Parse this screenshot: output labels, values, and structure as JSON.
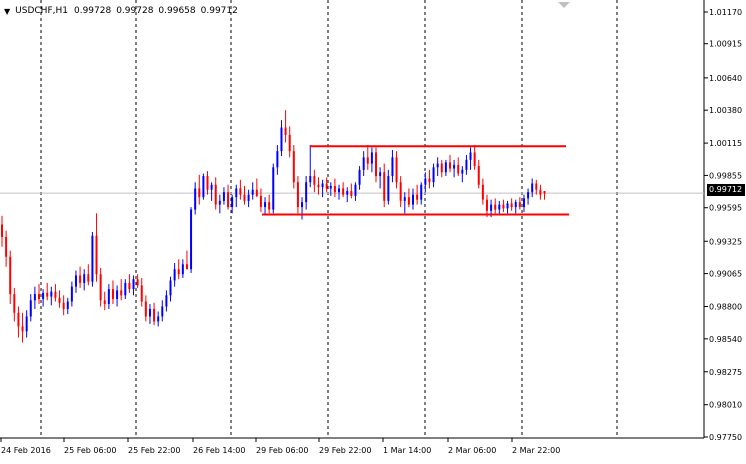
{
  "header": {
    "arrow_icon": "triangle-down-icon",
    "symbol": "USDCHF,H1",
    "open": "0.99728",
    "high": "0.99728",
    "low": "0.99658",
    "close": "0.99712"
  },
  "current_price_label": "0.99712",
  "colors": {
    "bull": "#0000ff",
    "bear": "#ff0000",
    "wick": "#000000",
    "grid": "#000000",
    "level_line": "#ff0000",
    "current_line": "#c0c0c0",
    "background": "#ffffff"
  },
  "chart_data": {
    "type": "candlestick",
    "symbol": "USDCHF",
    "timeframe": "H1",
    "ylim": [
      0.9772,
      1.0122
    ],
    "y_ticks": [
      "1.01170",
      "1.00915",
      "1.00640",
      "1.00380",
      "1.00115",
      "0.99855",
      "0.99595",
      "0.99325",
      "0.99065",
      "0.98800",
      "0.98540",
      "0.98275",
      "0.98010",
      "0.97750"
    ],
    "x_ticks": [
      "24 Feb 2016",
      "25 Feb 06:00",
      "25 Feb 22:00",
      "26 Feb 14:00",
      "29 Feb 06:00",
      "29 Feb 22:00",
      "1 Mar 14:00",
      "2 Mar 06:00",
      "2 Mar 22:00"
    ],
    "grid": "vertical dashed",
    "current_price": 0.99712,
    "resistance": 1.0009,
    "support": 0.9954,
    "candles": [
      [
        0.9946,
        0.9953,
        0.9928,
        0.9936
      ],
      [
        0.9936,
        0.9941,
        0.9912,
        0.992
      ],
      [
        0.992,
        0.9925,
        0.9882,
        0.989
      ],
      [
        0.989,
        0.9895,
        0.9868,
        0.9875
      ],
      [
        0.9875,
        0.988,
        0.9855,
        0.9864
      ],
      [
        0.9864,
        0.9875,
        0.9851,
        0.986
      ],
      [
        0.986,
        0.9877,
        0.9855,
        0.9872
      ],
      [
        0.9872,
        0.989,
        0.9868,
        0.9885
      ],
      [
        0.9885,
        0.9896,
        0.9878,
        0.989
      ],
      [
        0.989,
        0.9898,
        0.9882,
        0.9886
      ],
      [
        0.9886,
        0.9894,
        0.988,
        0.9891
      ],
      [
        0.9891,
        0.9899,
        0.9885,
        0.9888
      ],
      [
        0.9888,
        0.9896,
        0.9881,
        0.9892
      ],
      [
        0.9892,
        0.9898,
        0.9884,
        0.9887
      ],
      [
        0.9887,
        0.9893,
        0.9879,
        0.9883
      ],
      [
        0.9883,
        0.9889,
        0.9873,
        0.9878
      ],
      [
        0.9878,
        0.9887,
        0.9874,
        0.9884
      ],
      [
        0.9884,
        0.99,
        0.988,
        0.9896
      ],
      [
        0.9896,
        0.9909,
        0.9891,
        0.9905
      ],
      [
        0.9905,
        0.9912,
        0.9895,
        0.9899
      ],
      [
        0.9899,
        0.991,
        0.9893,
        0.9906
      ],
      [
        0.9906,
        0.9914,
        0.9897,
        0.99
      ],
      [
        0.99,
        0.994,
        0.9896,
        0.9937
      ],
      [
        0.9937,
        0.9955,
        0.99,
        0.9906
      ],
      [
        0.9906,
        0.9911,
        0.988,
        0.9885
      ],
      [
        0.9885,
        0.9892,
        0.9877,
        0.9882
      ],
      [
        0.9882,
        0.9898,
        0.9878,
        0.9894
      ],
      [
        0.9894,
        0.9901,
        0.9882,
        0.9886
      ],
      [
        0.9886,
        0.9897,
        0.988,
        0.9893
      ],
      [
        0.9893,
        0.9902,
        0.9885,
        0.9889
      ],
      [
        0.9889,
        0.9902,
        0.9886,
        0.9899
      ],
      [
        0.9899,
        0.9906,
        0.9891,
        0.9894
      ],
      [
        0.9894,
        0.9905,
        0.9889,
        0.9902
      ],
      [
        0.9902,
        0.9906,
        0.9895,
        0.9897
      ],
      [
        0.9897,
        0.9903,
        0.988,
        0.9884
      ],
      [
        0.9884,
        0.9889,
        0.9868,
        0.9872
      ],
      [
        0.9872,
        0.9882,
        0.9866,
        0.9878
      ],
      [
        0.9878,
        0.9883,
        0.9865,
        0.9868
      ],
      [
        0.9868,
        0.9876,
        0.9864,
        0.9872
      ],
      [
        0.9872,
        0.9885,
        0.9868,
        0.988
      ],
      [
        0.988,
        0.9893,
        0.9876,
        0.9889
      ],
      [
        0.9889,
        0.9904,
        0.9884,
        0.9901
      ],
      [
        0.9901,
        0.9915,
        0.9896,
        0.991
      ],
      [
        0.991,
        0.9918,
        0.9902,
        0.9906
      ],
      [
        0.9906,
        0.9918,
        0.9903,
        0.9914
      ],
      [
        0.9914,
        0.9925,
        0.991,
        0.991
      ],
      [
        0.991,
        0.996,
        0.9907,
        0.9958
      ],
      [
        0.9958,
        0.998,
        0.9954,
        0.9975
      ],
      [
        0.9975,
        0.9986,
        0.9962,
        0.9968
      ],
      [
        0.9968,
        0.9987,
        0.9966,
        0.9985
      ],
      [
        0.9985,
        0.9989,
        0.997,
        0.9974
      ],
      [
        0.9974,
        0.998,
        0.9965,
        0.9978
      ],
      [
        0.9978,
        0.9984,
        0.9958,
        0.9962
      ],
      [
        0.9962,
        0.997,
        0.9955,
        0.9965
      ],
      [
        0.9965,
        0.9976,
        0.9962,
        0.9972
      ],
      [
        0.9972,
        0.9978,
        0.9958,
        0.996
      ],
      [
        0.996,
        0.997,
        0.9955,
        0.9968
      ],
      [
        0.9968,
        0.9978,
        0.996,
        0.9975
      ],
      [
        0.9975,
        0.9982,
        0.9966,
        0.997
      ],
      [
        0.997,
        0.9977,
        0.9962,
        0.9965
      ],
      [
        0.9965,
        0.9974,
        0.996,
        0.997
      ],
      [
        0.997,
        0.998,
        0.9966,
        0.9974
      ],
      [
        0.9974,
        0.9983,
        0.9968,
        0.9969
      ],
      [
        0.9969,
        0.9975,
        0.9956,
        0.996
      ],
      [
        0.996,
        0.9968,
        0.9954,
        0.9964
      ],
      [
        0.9964,
        0.997,
        0.9955,
        0.9958
      ],
      [
        0.9958,
        0.9995,
        0.9955,
        0.9992
      ],
      [
        0.9992,
        1.001,
        0.9986,
        1.0005
      ],
      [
        1.0005,
        1.003,
        1.0001,
        1.0024
      ],
      [
        1.0024,
        1.0038,
        1.0012,
        1.0018
      ],
      [
        1.0018,
        1.0025,
        1.0,
        1.0005
      ],
      [
        1.0005,
        1.001,
        0.9975,
        0.998
      ],
      [
        0.998,
        0.9985,
        0.9955,
        0.996
      ],
      [
        0.996,
        0.9968,
        0.995,
        0.9964
      ],
      [
        0.9964,
        0.9985,
        0.9958,
        0.998
      ],
      [
        0.998,
        1.001,
        0.9976,
        0.9985
      ],
      [
        0.9985,
        0.999,
        0.9972,
        0.9978
      ],
      [
        0.9978,
        0.9984,
        0.997,
        0.9976
      ],
      [
        0.9976,
        0.9982,
        0.9968,
        0.9979
      ],
      [
        0.9979,
        0.9984,
        0.9972,
        0.9975
      ],
      [
        0.9975,
        0.998,
        0.9969,
        0.9977
      ],
      [
        0.9977,
        0.9983,
        0.9968,
        0.9972
      ],
      [
        0.9972,
        0.9978,
        0.9966,
        0.9975
      ],
      [
        0.9975,
        0.998,
        0.9968,
        0.997
      ],
      [
        0.997,
        0.9976,
        0.9964,
        0.9973
      ],
      [
        0.9973,
        0.9979,
        0.9967,
        0.9969
      ],
      [
        0.9969,
        0.998,
        0.9965,
        0.9978
      ],
      [
        0.9978,
        0.9993,
        0.9974,
        0.999
      ],
      [
        0.999,
        1.0005,
        0.9985,
        1.0
      ],
      [
        1.0,
        1.001,
        0.999,
        0.9995
      ],
      [
        0.9995,
        1.0008,
        0.9988,
        1.0004
      ],
      [
        1.0004,
        1.0008,
        0.998,
        0.9985
      ],
      [
        0.9985,
        0.9992,
        0.9975,
        0.9988
      ],
      [
        0.9988,
        0.9995,
        0.996,
        0.9965
      ],
      [
        0.9965,
        0.999,
        0.9962,
        0.9985
      ],
      [
        0.9985,
        1.0006,
        0.998,
        1.0
      ],
      [
        1.0,
        1.0005,
        0.9975,
        0.998
      ],
      [
        0.998,
        0.9985,
        0.996,
        0.9965
      ],
      [
        0.9965,
        0.9972,
        0.9955,
        0.9968
      ],
      [
        0.9968,
        0.9975,
        0.996,
        0.9962
      ],
      [
        0.9962,
        0.9975,
        0.9958,
        0.997
      ],
      [
        0.997,
        0.9978,
        0.9962,
        0.9966
      ],
      [
        0.9966,
        0.998,
        0.9962,
        0.9978
      ],
      [
        0.9978,
        0.9988,
        0.9972,
        0.9983
      ],
      [
        0.9983,
        0.999,
        0.9975,
        0.998
      ],
      [
        0.998,
        0.9995,
        0.9976,
        0.9992
      ],
      [
        0.9992,
        1.0,
        0.9985,
        0.9995
      ],
      [
        0.9995,
        0.9998,
        0.9984,
        0.9988
      ],
      [
        0.9988,
        0.9998,
        0.9985,
        0.9996
      ],
      [
        0.9996,
        1.0002,
        0.9988,
        0.9991
      ],
      [
        0.9991,
        0.9998,
        0.9984,
        0.9994
      ],
      [
        0.9994,
        1.0,
        0.9985,
        0.9987
      ],
      [
        0.9987,
        0.9993,
        0.998,
        0.999
      ],
      [
        0.999,
        1.0002,
        0.9986,
        0.9998
      ],
      [
        0.9998,
        1.0008,
        0.999,
        1.0004
      ],
      [
        1.0004,
        1.001,
        0.999,
        0.9993
      ],
      [
        0.9993,
        0.9998,
        0.9975,
        0.9978
      ],
      [
        0.9978,
        0.9983,
        0.9962,
        0.9966
      ],
      [
        0.9966,
        0.997,
        0.9952,
        0.9957
      ],
      [
        0.9957,
        0.9966,
        0.9952,
        0.9962
      ],
      [
        0.9962,
        0.9967,
        0.9955,
        0.9958
      ],
      [
        0.9958,
        0.9965,
        0.9954,
        0.9962
      ],
      [
        0.9962,
        0.9966,
        0.9956,
        0.9959
      ],
      [
        0.9959,
        0.9965,
        0.9955,
        0.9963
      ],
      [
        0.9963,
        0.9967,
        0.9957,
        0.996
      ],
      [
        0.996,
        0.9966,
        0.9955,
        0.9964
      ],
      [
        0.9964,
        0.9968,
        0.9958,
        0.996
      ],
      [
        0.996,
        0.997,
        0.9956,
        0.9967
      ],
      [
        0.9967,
        0.9975,
        0.9962,
        0.9972
      ],
      [
        0.9972,
        0.9983,
        0.9968,
        0.9979
      ],
      [
        0.9979,
        0.9982,
        0.997,
        0.9974
      ],
      [
        0.9974,
        0.9978,
        0.9966,
        0.997
      ],
      [
        0.9973,
        0.9973,
        0.9966,
        0.9971
      ]
    ]
  }
}
